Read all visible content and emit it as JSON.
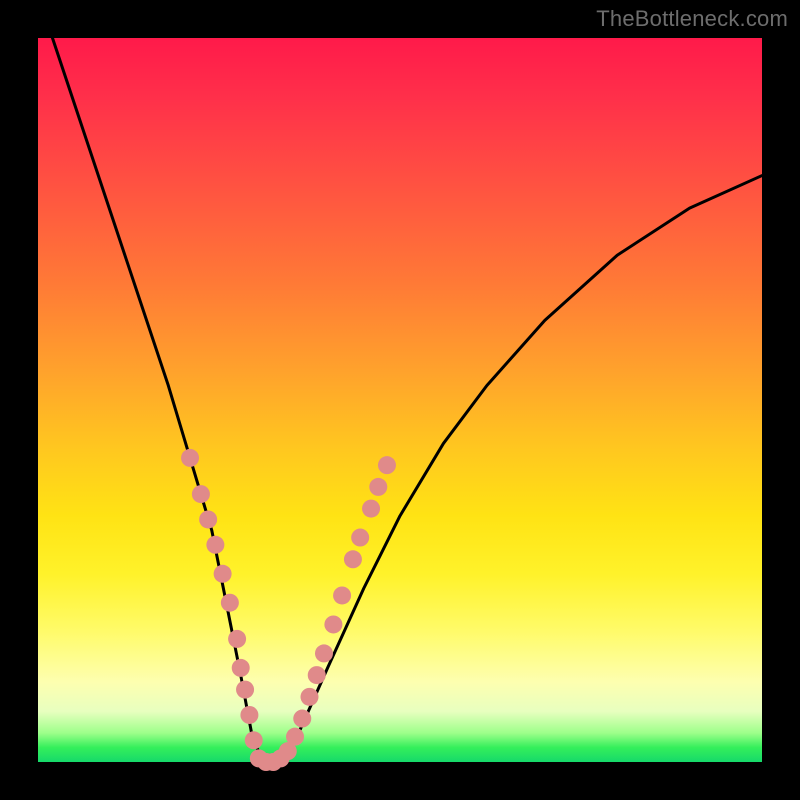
{
  "watermark": "TheBottleneck.com",
  "chart_data": {
    "type": "line",
    "title": "",
    "xlabel": "",
    "ylabel": "",
    "xlim": [
      0,
      100
    ],
    "ylim": [
      0,
      100
    ],
    "series": [
      {
        "name": "bottleneck-curve",
        "color": "#000000",
        "x": [
          2,
          6,
          10,
          14,
          18,
          21,
          24,
          26,
          28,
          29.5,
          31,
          33,
          36,
          40,
          45,
          50,
          56,
          62,
          70,
          80,
          90,
          100
        ],
        "y": [
          100,
          88,
          76,
          64,
          52,
          42,
          32,
          22,
          12,
          4,
          0,
          0,
          4,
          13,
          24,
          34,
          44,
          52,
          61,
          70,
          76.5,
          81
        ]
      }
    ],
    "markers": [
      {
        "name": "left-branch-dots",
        "color": "#e08a8a",
        "radius": 9,
        "points": [
          {
            "x": 21.0,
            "y": 42.0
          },
          {
            "x": 22.5,
            "y": 37.0
          },
          {
            "x": 23.5,
            "y": 33.5
          },
          {
            "x": 24.5,
            "y": 30.0
          },
          {
            "x": 25.5,
            "y": 26.0
          },
          {
            "x": 26.5,
            "y": 22.0
          },
          {
            "x": 27.5,
            "y": 17.0
          },
          {
            "x": 28.0,
            "y": 13.0
          },
          {
            "x": 28.6,
            "y": 10.0
          },
          {
            "x": 29.2,
            "y": 6.5
          },
          {
            "x": 29.8,
            "y": 3.0
          }
        ]
      },
      {
        "name": "valley-dots",
        "color": "#e08a8a",
        "radius": 9,
        "points": [
          {
            "x": 30.5,
            "y": 0.5
          },
          {
            "x": 31.5,
            "y": 0.0
          },
          {
            "x": 32.5,
            "y": 0.0
          },
          {
            "x": 33.5,
            "y": 0.5
          },
          {
            "x": 34.5,
            "y": 1.5
          }
        ]
      },
      {
        "name": "right-branch-dots",
        "color": "#e08a8a",
        "radius": 9,
        "points": [
          {
            "x": 35.5,
            "y": 3.5
          },
          {
            "x": 36.5,
            "y": 6.0
          },
          {
            "x": 37.5,
            "y": 9.0
          },
          {
            "x": 38.5,
            "y": 12.0
          },
          {
            "x": 39.5,
            "y": 15.0
          },
          {
            "x": 40.8,
            "y": 19.0
          },
          {
            "x": 42.0,
            "y": 23.0
          },
          {
            "x": 43.5,
            "y": 28.0
          },
          {
            "x": 44.5,
            "y": 31.0
          },
          {
            "x": 46.0,
            "y": 35.0
          },
          {
            "x": 47.0,
            "y": 38.0
          },
          {
            "x": 48.2,
            "y": 41.0
          }
        ]
      }
    ]
  }
}
